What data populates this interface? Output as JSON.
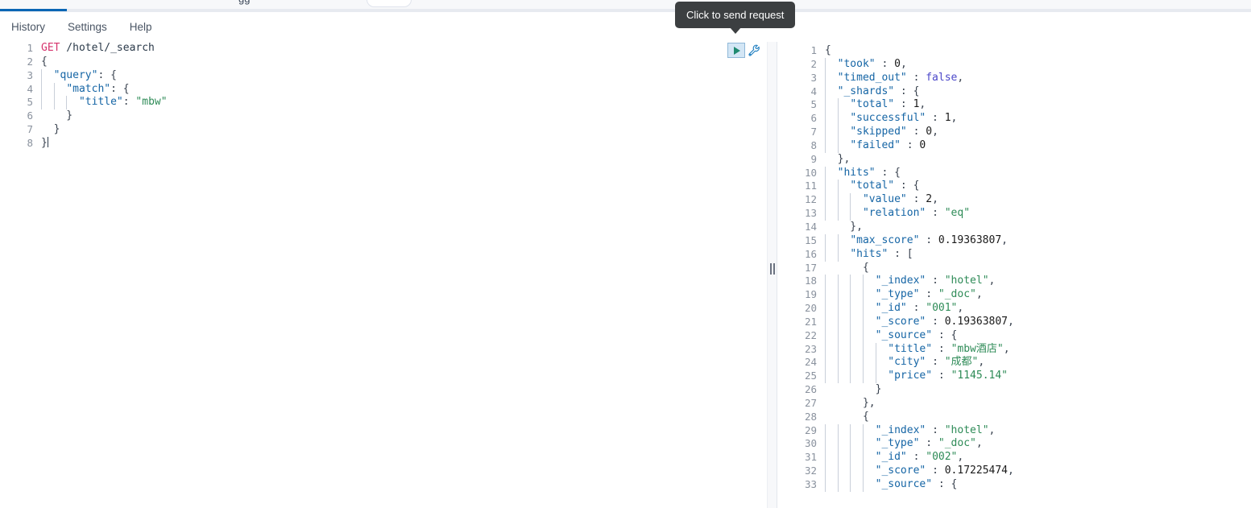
{
  "window": {
    "top_strip_text": "gg",
    "tab_active_indicator_color": "#0a66b5"
  },
  "menubar": {
    "items": [
      {
        "label": "History",
        "name": "menu-history"
      },
      {
        "label": "Settings",
        "name": "menu-settings"
      },
      {
        "label": "Help",
        "name": "menu-help"
      }
    ]
  },
  "toolbar": {
    "tooltip": "Click to send request",
    "play_icon": "play-icon",
    "wrench_icon": "wrench-icon"
  },
  "request_editor": {
    "name": "request-console",
    "gutter": [
      "1",
      "2",
      "3",
      "4",
      "5",
      "6",
      "7",
      "8"
    ],
    "folds": [
      "",
      "▾",
      "▾",
      "▾",
      "",
      "▴",
      "▴",
      "▴"
    ],
    "lines": [
      [
        {
          "t": "GET",
          "c": "t-method"
        },
        {
          "t": " /hotel/_search",
          "c": "t-url"
        }
      ],
      [
        {
          "t": "{",
          "c": "t-punct"
        }
      ],
      [
        {
          "t": "  ",
          "c": "t-punct"
        },
        {
          "t": "\"query\"",
          "c": "t-key"
        },
        {
          "t": ": {",
          "c": "t-punct"
        }
      ],
      [
        {
          "t": "    ",
          "c": "t-punct"
        },
        {
          "t": "\"match\"",
          "c": "t-key"
        },
        {
          "t": ": {",
          "c": "t-punct"
        }
      ],
      [
        {
          "t": "      ",
          "c": "t-punct"
        },
        {
          "t": "\"title\"",
          "c": "t-key"
        },
        {
          "t": ": ",
          "c": "t-punct"
        },
        {
          "t": "\"mbw\"",
          "c": "t-str"
        }
      ],
      [
        {
          "t": "    }",
          "c": "t-punct"
        }
      ],
      [
        {
          "t": "  }",
          "c": "t-punct"
        }
      ],
      [
        {
          "t": "}",
          "c": "t-punct"
        }
      ]
    ],
    "selection_lines": 8,
    "active_line": 8
  },
  "response_editor": {
    "name": "response-console",
    "gutter": [
      "1",
      "2",
      "3",
      "4",
      "5",
      "6",
      "7",
      "8",
      "9",
      "10",
      "11",
      "12",
      "13",
      "14",
      "15",
      "16",
      "17",
      "18",
      "19",
      "20",
      "21",
      "22",
      "23",
      "24",
      "25",
      "26",
      "27",
      "28",
      "29",
      "30",
      "31",
      "32",
      "33"
    ],
    "folds": [
      "▾",
      "",
      "",
      "▾",
      "",
      "",
      "",
      "",
      "▴",
      "▾",
      "▾",
      "",
      "",
      "▴",
      "",
      "▾",
      "▾",
      "",
      "",
      "",
      "",
      "▾",
      "",
      "",
      "",
      "▴",
      "▴",
      "▾",
      "",
      "",
      "",
      "",
      "▾"
    ],
    "lines": [
      [
        {
          "t": "{",
          "c": "t-punct"
        }
      ],
      [
        {
          "t": "  ",
          "c": "t-punct"
        },
        {
          "t": "\"took\"",
          "c": "t-key"
        },
        {
          "t": " : ",
          "c": "t-punct"
        },
        {
          "t": "0",
          "c": "t-num"
        },
        {
          "t": ",",
          "c": "t-punct"
        }
      ],
      [
        {
          "t": "  ",
          "c": "t-punct"
        },
        {
          "t": "\"timed_out\"",
          "c": "t-key"
        },
        {
          "t": " : ",
          "c": "t-punct"
        },
        {
          "t": "false",
          "c": "t-bool"
        },
        {
          "t": ",",
          "c": "t-punct"
        }
      ],
      [
        {
          "t": "  ",
          "c": "t-punct"
        },
        {
          "t": "\"_shards\"",
          "c": "t-key"
        },
        {
          "t": " : {",
          "c": "t-punct"
        }
      ],
      [
        {
          "t": "    ",
          "c": "t-punct"
        },
        {
          "t": "\"total\"",
          "c": "t-key"
        },
        {
          "t": " : ",
          "c": "t-punct"
        },
        {
          "t": "1",
          "c": "t-num"
        },
        {
          "t": ",",
          "c": "t-punct"
        }
      ],
      [
        {
          "t": "    ",
          "c": "t-punct"
        },
        {
          "t": "\"successful\"",
          "c": "t-key"
        },
        {
          "t": " : ",
          "c": "t-punct"
        },
        {
          "t": "1",
          "c": "t-num"
        },
        {
          "t": ",",
          "c": "t-punct"
        }
      ],
      [
        {
          "t": "    ",
          "c": "t-punct"
        },
        {
          "t": "\"skipped\"",
          "c": "t-key"
        },
        {
          "t": " : ",
          "c": "t-punct"
        },
        {
          "t": "0",
          "c": "t-num"
        },
        {
          "t": ",",
          "c": "t-punct"
        }
      ],
      [
        {
          "t": "    ",
          "c": "t-punct"
        },
        {
          "t": "\"failed\"",
          "c": "t-key"
        },
        {
          "t": " : ",
          "c": "t-punct"
        },
        {
          "t": "0",
          "c": "t-num"
        }
      ],
      [
        {
          "t": "  },",
          "c": "t-punct"
        }
      ],
      [
        {
          "t": "  ",
          "c": "t-punct"
        },
        {
          "t": "\"hits\"",
          "c": "t-key"
        },
        {
          "t": " : {",
          "c": "t-punct"
        }
      ],
      [
        {
          "t": "    ",
          "c": "t-punct"
        },
        {
          "t": "\"total\"",
          "c": "t-key"
        },
        {
          "t": " : {",
          "c": "t-punct"
        }
      ],
      [
        {
          "t": "      ",
          "c": "t-punct"
        },
        {
          "t": "\"value\"",
          "c": "t-key"
        },
        {
          "t": " : ",
          "c": "t-punct"
        },
        {
          "t": "2",
          "c": "t-num"
        },
        {
          "t": ",",
          "c": "t-punct"
        }
      ],
      [
        {
          "t": "      ",
          "c": "t-punct"
        },
        {
          "t": "\"relation\"",
          "c": "t-key"
        },
        {
          "t": " : ",
          "c": "t-punct"
        },
        {
          "t": "\"eq\"",
          "c": "t-str"
        }
      ],
      [
        {
          "t": "    },",
          "c": "t-punct"
        }
      ],
      [
        {
          "t": "    ",
          "c": "t-punct"
        },
        {
          "t": "\"max_score\"",
          "c": "t-key"
        },
        {
          "t": " : ",
          "c": "t-punct"
        },
        {
          "t": "0.19363807",
          "c": "t-num"
        },
        {
          "t": ",",
          "c": "t-punct"
        }
      ],
      [
        {
          "t": "    ",
          "c": "t-punct"
        },
        {
          "t": "\"hits\"",
          "c": "t-key"
        },
        {
          "t": " : [",
          "c": "t-punct"
        }
      ],
      [
        {
          "t": "      {",
          "c": "t-punct"
        }
      ],
      [
        {
          "t": "        ",
          "c": "t-punct"
        },
        {
          "t": "\"_index\"",
          "c": "t-key"
        },
        {
          "t": " : ",
          "c": "t-punct"
        },
        {
          "t": "\"hotel\"",
          "c": "t-str"
        },
        {
          "t": ",",
          "c": "t-punct"
        }
      ],
      [
        {
          "t": "        ",
          "c": "t-punct"
        },
        {
          "t": "\"_type\"",
          "c": "t-key"
        },
        {
          "t": " : ",
          "c": "t-punct"
        },
        {
          "t": "\"_doc\"",
          "c": "t-str"
        },
        {
          "t": ",",
          "c": "t-punct"
        }
      ],
      [
        {
          "t": "        ",
          "c": "t-punct"
        },
        {
          "t": "\"_id\"",
          "c": "t-key"
        },
        {
          "t": " : ",
          "c": "t-punct"
        },
        {
          "t": "\"001\"",
          "c": "t-str"
        },
        {
          "t": ",",
          "c": "t-punct"
        }
      ],
      [
        {
          "t": "        ",
          "c": "t-punct"
        },
        {
          "t": "\"_score\"",
          "c": "t-key"
        },
        {
          "t": " : ",
          "c": "t-punct"
        },
        {
          "t": "0.19363807",
          "c": "t-num"
        },
        {
          "t": ",",
          "c": "t-punct"
        }
      ],
      [
        {
          "t": "        ",
          "c": "t-punct"
        },
        {
          "t": "\"_source\"",
          "c": "t-key"
        },
        {
          "t": " : {",
          "c": "t-punct"
        }
      ],
      [
        {
          "t": "          ",
          "c": "t-punct"
        },
        {
          "t": "\"title\"",
          "c": "t-key"
        },
        {
          "t": " : ",
          "c": "t-punct"
        },
        {
          "t": "\"mbw酒店\"",
          "c": "t-str"
        },
        {
          "t": ",",
          "c": "t-punct"
        }
      ],
      [
        {
          "t": "          ",
          "c": "t-punct"
        },
        {
          "t": "\"city\"",
          "c": "t-key"
        },
        {
          "t": " : ",
          "c": "t-punct"
        },
        {
          "t": "\"成都\"",
          "c": "t-str"
        },
        {
          "t": ",",
          "c": "t-punct"
        }
      ],
      [
        {
          "t": "          ",
          "c": "t-punct"
        },
        {
          "t": "\"price\"",
          "c": "t-key"
        },
        {
          "t": " : ",
          "c": "t-punct"
        },
        {
          "t": "\"1145.14\"",
          "c": "t-str"
        }
      ],
      [
        {
          "t": "        }",
          "c": "t-punct"
        }
      ],
      [
        {
          "t": "      },",
          "c": "t-punct"
        }
      ],
      [
        {
          "t": "      {",
          "c": "t-punct"
        }
      ],
      [
        {
          "t": "        ",
          "c": "t-punct"
        },
        {
          "t": "\"_index\"",
          "c": "t-key"
        },
        {
          "t": " : ",
          "c": "t-punct"
        },
        {
          "t": "\"hotel\"",
          "c": "t-str"
        },
        {
          "t": ",",
          "c": "t-punct"
        }
      ],
      [
        {
          "t": "        ",
          "c": "t-punct"
        },
        {
          "t": "\"_type\"",
          "c": "t-key"
        },
        {
          "t": " : ",
          "c": "t-punct"
        },
        {
          "t": "\"_doc\"",
          "c": "t-str"
        },
        {
          "t": ",",
          "c": "t-punct"
        }
      ],
      [
        {
          "t": "        ",
          "c": "t-punct"
        },
        {
          "t": "\"_id\"",
          "c": "t-key"
        },
        {
          "t": " : ",
          "c": "t-punct"
        },
        {
          "t": "\"002\"",
          "c": "t-str"
        },
        {
          "t": ",",
          "c": "t-punct"
        }
      ],
      [
        {
          "t": "        ",
          "c": "t-punct"
        },
        {
          "t": "\"_score\"",
          "c": "t-key"
        },
        {
          "t": " : ",
          "c": "t-punct"
        },
        {
          "t": "0.17225474",
          "c": "t-num"
        },
        {
          "t": ",",
          "c": "t-punct"
        }
      ],
      [
        {
          "t": "        ",
          "c": "t-punct"
        },
        {
          "t": "\"_source\"",
          "c": "t-key"
        },
        {
          "t": " : {",
          "c": "t-punct"
        }
      ]
    ],
    "active_line": 1
  },
  "splitter": {
    "name": "panel-splitter"
  }
}
